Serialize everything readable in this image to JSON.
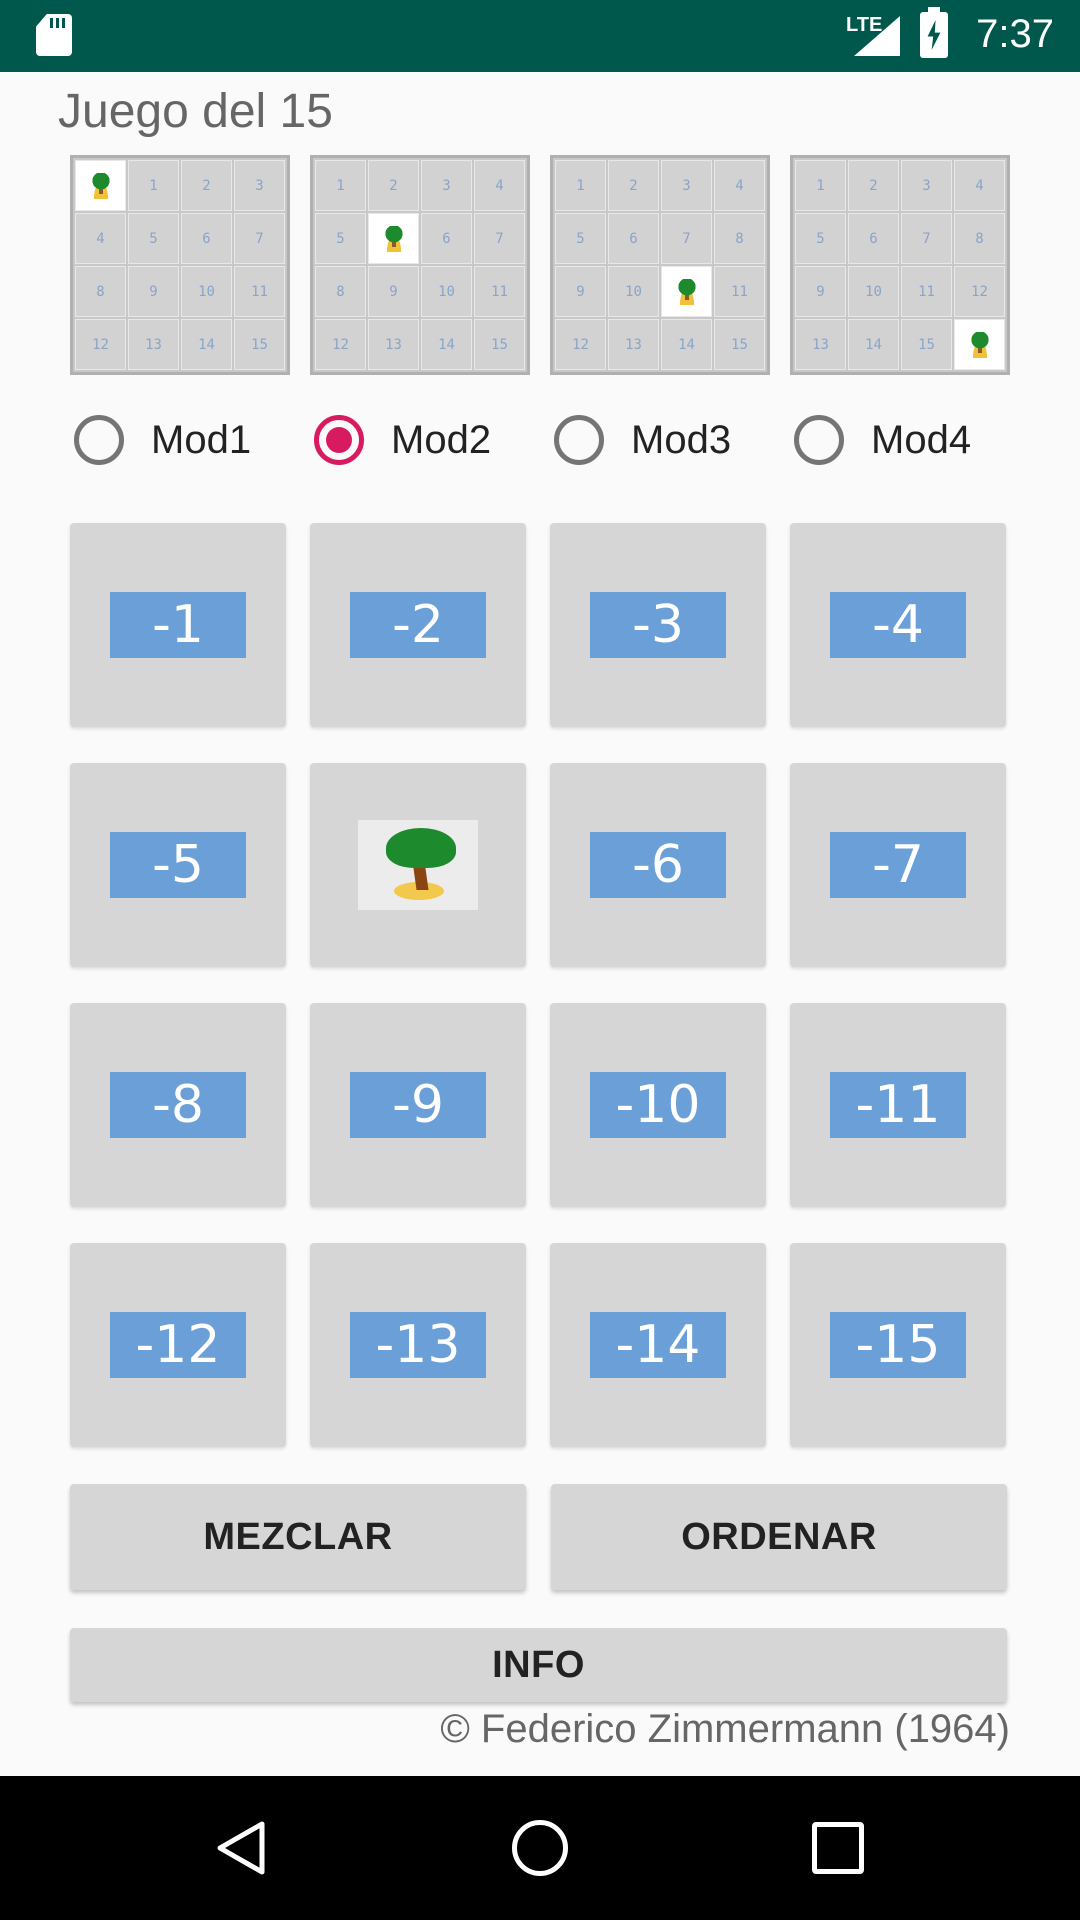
{
  "status_bar": {
    "time": "7:37",
    "network": "LTE",
    "icons": [
      "sd-card-icon",
      "lte-signal-icon",
      "battery-charging-icon"
    ]
  },
  "app": {
    "title": "Juego del 15"
  },
  "thumbnails": [
    {
      "name": "Mod1",
      "tiles": [
        "",
        "1",
        "2",
        "3",
        "4",
        "5",
        "6",
        "7",
        "8",
        "9",
        "10",
        "11",
        "12",
        "13",
        "14",
        "15"
      ]
    },
    {
      "name": "Mod2",
      "tiles": [
        "1",
        "2",
        "3",
        "4",
        "5",
        "",
        "6",
        "7",
        "8",
        "9",
        "10",
        "11",
        "12",
        "13",
        "14",
        "15"
      ]
    },
    {
      "name": "Mod3",
      "tiles": [
        "1",
        "2",
        "3",
        "4",
        "5",
        "6",
        "7",
        "8",
        "9",
        "10",
        "",
        "11",
        "12",
        "13",
        "14",
        "15"
      ]
    },
    {
      "name": "Mod4",
      "tiles": [
        "1",
        "2",
        "3",
        "4",
        "5",
        "6",
        "7",
        "8",
        "9",
        "10",
        "11",
        "12",
        "13",
        "14",
        "15",
        ""
      ]
    }
  ],
  "modes": [
    {
      "label": "Mod1",
      "checked": false
    },
    {
      "label": "Mod2",
      "checked": true
    },
    {
      "label": "Mod3",
      "checked": false
    },
    {
      "label": "Mod4",
      "checked": false
    }
  ],
  "board": {
    "tiles": [
      "-1",
      "-2",
      "-3",
      "-4",
      "-5",
      "",
      "-6",
      "-7",
      "-8",
      "-9",
      "-10",
      "-11",
      "-12",
      "-13",
      "-14",
      "-15"
    ],
    "empty_icon": "palm-island-icon"
  },
  "buttons": {
    "shuffle": "MEZCLAR",
    "sort": "ORDENAR",
    "info": "INFO"
  },
  "footer": {
    "copyright": "© Federico Zimmermann (1964)"
  },
  "colors": {
    "status_bar": "#00574b",
    "accent": "#d81b60",
    "tile_label": "#6a9fd8",
    "tile_bg": "#d6d6d6"
  }
}
